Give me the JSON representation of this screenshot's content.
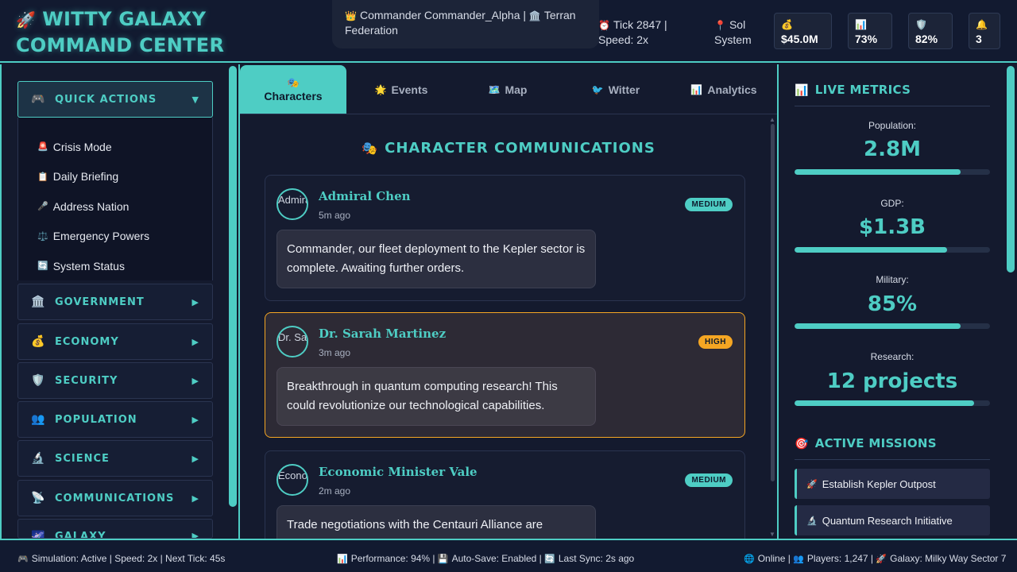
{
  "header": {
    "title": "WITTY GALAXY COMMAND CENTER",
    "title_icon": "rocket-icon",
    "commander": "Commander Commander_Alpha",
    "faction": "Terran Federation",
    "tick": "Tick 2847 |",
    "speed": "Speed: 2x",
    "location": "Sol System",
    "stats": [
      {
        "icon": "💰",
        "value": "$45.0M"
      },
      {
        "icon": "📊",
        "value": "73%"
      },
      {
        "icon": "🛡️",
        "value": "82%"
      },
      {
        "icon": "🔔",
        "value": "3"
      }
    ]
  },
  "sidebar": {
    "quick_actions": {
      "label": "QUICK ACTIONS",
      "items": [
        {
          "icon": "🚨",
          "label": "Crisis Mode"
        },
        {
          "icon": "📋",
          "label": "Daily Briefing"
        },
        {
          "icon": "🎤",
          "label": "Address Nation"
        },
        {
          "icon": "⚖️",
          "label": "Emergency Powers"
        },
        {
          "icon": "🔄",
          "label": "System Status"
        }
      ]
    },
    "menus": [
      {
        "icon": "🏛️",
        "label": "GOVERNMENT"
      },
      {
        "icon": "💰",
        "label": "ECONOMY"
      },
      {
        "icon": "🛡️",
        "label": "SECURITY"
      },
      {
        "icon": "👥",
        "label": "POPULATION"
      },
      {
        "icon": "🔬",
        "label": "SCIENCE"
      },
      {
        "icon": "📡",
        "label": "COMMUNICATIONS"
      },
      {
        "icon": "🌌",
        "label": "GALAXY"
      }
    ]
  },
  "tabs": [
    {
      "icon": "🎭",
      "label": "Characters"
    },
    {
      "icon": "🌟",
      "label": "Events"
    },
    {
      "icon": "🗺️",
      "label": "Map"
    },
    {
      "icon": "🐦",
      "label": "Witter"
    },
    {
      "icon": "📊",
      "label": "Analytics"
    }
  ],
  "main": {
    "title": "CHARACTER COMMUNICATIONS",
    "messages": [
      {
        "name": "Admiral Chen",
        "avatar_alt": "Admiral Chen",
        "time": "5m ago",
        "priority": "MEDIUM",
        "text": "Commander, our fleet deployment to the Kepler sector is complete. Awaiting further orders."
      },
      {
        "name": "Dr. Sarah Martinez",
        "avatar_alt": "Dr. Sarah Martinez",
        "time": "3m ago",
        "priority": "HIGH",
        "text": "Breakthrough in quantum computing research! This could revolutionize our technological capabilities."
      },
      {
        "name": "Economic Minister Vale",
        "avatar_alt": "Economic Minister Vale",
        "time": "2m ago",
        "priority": "MEDIUM",
        "text": "Trade negotiations with the Centauri Alliance are"
      }
    ]
  },
  "right_panel": {
    "metrics_title": "LIVE METRICS",
    "metrics": [
      {
        "label": "Population:",
        "value": "2.8M",
        "fill": 0.85
      },
      {
        "label": "GDP:",
        "value": "$1.3B",
        "fill": 0.78
      },
      {
        "label": "Military:",
        "value": "85%",
        "fill": 0.85
      },
      {
        "label": "Research:",
        "value": "12 projects",
        "fill": 0.92
      }
    ],
    "missions_title": "ACTIVE MISSIONS",
    "missions": [
      {
        "icon": "🚀",
        "label": "Establish Kepler Outpost"
      },
      {
        "icon": "🔬",
        "label": "Quantum Research Initiative"
      }
    ]
  },
  "footer": {
    "left": "Simulation: Active | Speed: 2x | Next Tick: 45s",
    "performance": "Performance: 94% |",
    "autosave": "Auto-Save: Enabled |",
    "sync": "Last Sync: 2s ago",
    "online": "Online |",
    "players": "Players: 1,247 |",
    "galaxy": "Galaxy: Milky Way Sector 7"
  },
  "colors": {
    "accent": "#4ecdc4",
    "high": "#f5a623",
    "background": "#141a2e"
  }
}
